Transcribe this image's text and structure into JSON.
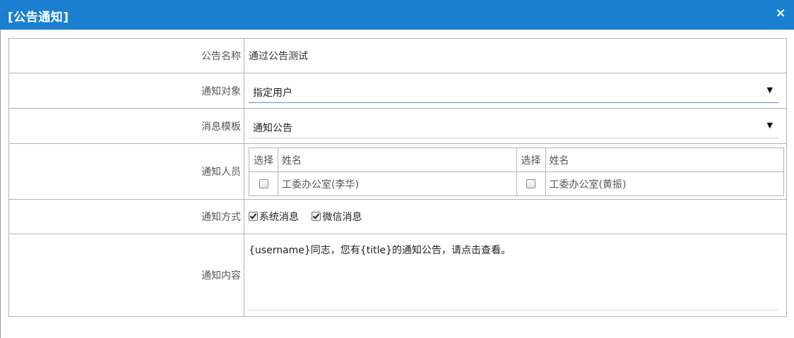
{
  "dialog": {
    "title": "[公告通知]",
    "close_label": "×"
  },
  "form": {
    "name_label": "公告名称",
    "name_value": "通过公告测试",
    "target_label": "通知对象",
    "target_value": "指定用户",
    "template_label": "消息模板",
    "template_value": "通知公告",
    "people_label": "通知人员",
    "people": {
      "headers": [
        "选择",
        "姓名",
        "选择",
        "姓名"
      ],
      "items": [
        {
          "name": "工委办公室(李华)",
          "checked": false
        },
        {
          "name": "工委办公室(黄振)",
          "checked": false
        }
      ]
    },
    "method_label": "通知方式",
    "methods": [
      {
        "label": "系统消息",
        "checked": true
      },
      {
        "label": "微信消息",
        "checked": true
      }
    ],
    "content_label": "通知内容",
    "content_value": "{username}同志，您有{title}的通知公告，请点击查看。"
  },
  "colors": {
    "titlebar": "#1a7fcf",
    "border": "#b3b3b3"
  },
  "icons": {
    "close": "close-icon",
    "dropdown": "caret-down-icon"
  }
}
